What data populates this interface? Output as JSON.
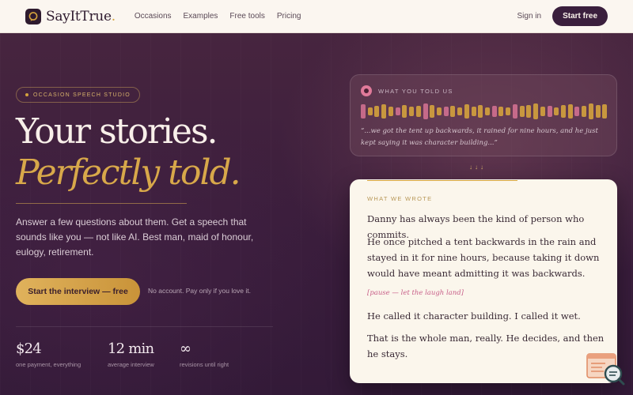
{
  "nav": {
    "brand": "SayItTrue",
    "brand_dot": ".",
    "links": [
      "Occasions",
      "Examples",
      "Free tools",
      "Pricing"
    ],
    "signin": "Sign in",
    "start_free": "Start free"
  },
  "hero": {
    "badge": "OCCASION SPEECH STUDIO",
    "headline_1": "Your stories.",
    "headline_2": "Perfectly told.",
    "subtext": "Answer a few questions about them. Get a speech that sounds like you — not like AI. Best man, maid of honour, eulogy, retirement.",
    "cta": "Start the interview — free",
    "cta_note": "No account. Pay only if you love it.",
    "stats": [
      {
        "value": "$24",
        "label": "one payment, everything"
      },
      {
        "value": "12 min",
        "label": "average interview"
      },
      {
        "value": "∞",
        "label": "revisions until right"
      }
    ]
  },
  "told": {
    "title": "WHAT YOU TOLD US",
    "quote": "“...we got the tent up backwards, it rained for nine hours, and he just kept saying it was character building...”"
  },
  "arrows": "↓↓↓",
  "wrote": {
    "title": "WHAT WE WROTE",
    "p1": "Danny has always been the kind of person who commits.",
    "p2": "He once pitched a tent backwards in the rain and stayed in it for nine hours, because taking it down would have meant admitting it was backwards.",
    "pause": "[pause — let the laugh land]",
    "p3": "He called it character building. I called it wet.",
    "p4": "That is the whole man, really. He decides, and then he stays."
  },
  "colors": {
    "accent_gold": "#d4a23d",
    "accent_pink": "#d07090",
    "background": "#3a1f3d",
    "nav_bg": "#fbf6f0",
    "card_bg": "#fbf6ec"
  },
  "icons": {
    "logo": "speech-bubble-logo-icon",
    "recording": "record-icon",
    "widget": "chat-search-icon"
  }
}
